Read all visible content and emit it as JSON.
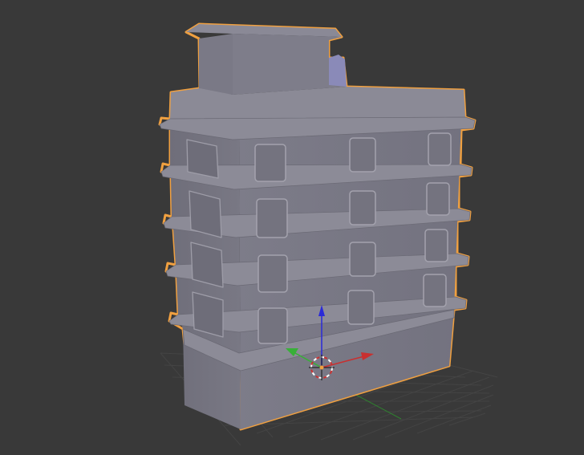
{
  "viewport": {
    "background": "#393939",
    "grid_color": "#4a4a4a",
    "selection_outline_color": "#f0a040",
    "mesh_color": "#7b7a87"
  },
  "object": {
    "type": "building-mesh",
    "floors": 4,
    "selected": true
  },
  "gizmo": {
    "axes": [
      {
        "name": "x-axis-arrow",
        "color": "#c83030"
      },
      {
        "name": "y-axis-arrow",
        "color": "#38b038"
      },
      {
        "name": "z-axis-arrow",
        "color": "#2a2ad8"
      }
    ],
    "cursor": "3d-cursor"
  }
}
